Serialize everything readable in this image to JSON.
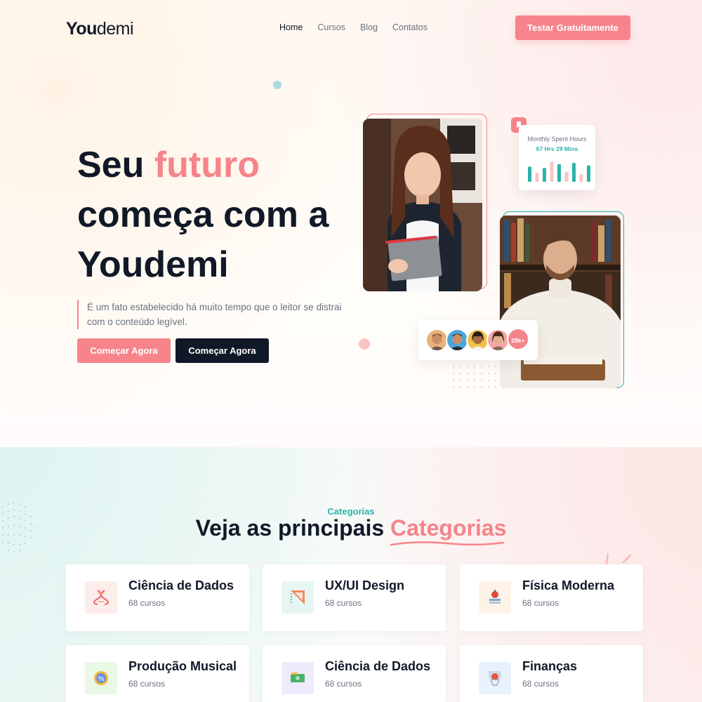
{
  "brand": {
    "bold": "You",
    "light": "demi"
  },
  "nav": [
    {
      "label": "Home",
      "active": true
    },
    {
      "label": "Cursos",
      "active": false
    },
    {
      "label": "Blog",
      "active": false
    },
    {
      "label": "Contatos",
      "active": false
    }
  ],
  "header": {
    "cta_label": "Testar Gratuitamente"
  },
  "hero": {
    "title_part1": "Seu ",
    "title_accent": "futuro",
    "title_part2": " começa com a Youdemi",
    "description": "É um fato estabelecido há muito tempo que o leitor se distrai com o conteúdo legível.",
    "primary_button": "Começar Agora",
    "secondary_button": "Começar Agora"
  },
  "stats_card": {
    "title": "Monthly Spent Hours",
    "value": "67 Hrs 29 Mins",
    "bars": [
      0.6,
      0.35,
      0.55,
      0.8,
      0.7,
      0.4,
      0.75,
      0.3,
      0.65
    ],
    "bar_colors": [
      "#2bb3a8",
      "#f9c3c6"
    ]
  },
  "students": {
    "count_label": "28k+"
  },
  "colors": {
    "accent": "#f6848a",
    "teal": "#2bb3a8",
    "dark": "#111827",
    "muted": "#6b7280"
  },
  "categories": {
    "kicker": "Categorias",
    "title_part1": "Veja as principais ",
    "title_accent": "Categorias",
    "items": [
      {
        "title": "Ciência de Dados",
        "count": "68 cursos",
        "icon": "dna-icon",
        "bg": "#fdeceb"
      },
      {
        "title": "UX/UI Design",
        "count": "68 cursos",
        "icon": "design-ruler-icon",
        "bg": "#e6f6f3"
      },
      {
        "title": "Física Moderna",
        "count": "68 cursos",
        "icon": "apple-books-icon",
        "bg": "#fdf3e7"
      },
      {
        "title": "Produção Musical",
        "count": "68 cursos",
        "icon": "percent-badge-icon",
        "bg": "#eaf8e6"
      },
      {
        "title": "Ciência de Dados",
        "count": "68 cursos",
        "icon": "money-bill-icon",
        "bg": "#efeafc"
      },
      {
        "title": "Finanças",
        "count": "68 cursos",
        "icon": "basketball-hoop-icon",
        "bg": "#e8f2fc"
      }
    ]
  }
}
